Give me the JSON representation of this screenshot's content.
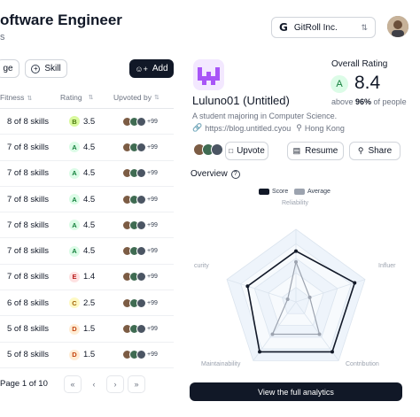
{
  "header": {
    "title": "oftware Engineer",
    "subtitle": "s",
    "org_name": "GitRoll Inc.",
    "org_logo": "G"
  },
  "toolbar": {
    "left_button_label": "ge",
    "skill_label": "Skill",
    "add_label": "Add"
  },
  "table": {
    "columns": [
      "Fitness",
      "Rating",
      "Upvoted by"
    ],
    "rows": [
      {
        "fitness": "8 of 8 skills",
        "grade": "B",
        "score": "3.5",
        "extra": "+99"
      },
      {
        "fitness": "7 of 8 skills",
        "grade": "A",
        "score": "4.5",
        "extra": "+99"
      },
      {
        "fitness": "7 of 8 skills",
        "grade": "A",
        "score": "4.5",
        "extra": "+99"
      },
      {
        "fitness": "7 of 8 skills",
        "grade": "A",
        "score": "4.5",
        "extra": "+99"
      },
      {
        "fitness": "7 of 8 skills",
        "grade": "A",
        "score": "4.5",
        "extra": "+99"
      },
      {
        "fitness": "7 of 8 skills",
        "grade": "A",
        "score": "4.5",
        "extra": "+99"
      },
      {
        "fitness": "7 of 8 skills",
        "grade": "E",
        "score": "1.4",
        "extra": "+99"
      },
      {
        "fitness": "6 of 8 skills",
        "grade": "C",
        "score": "2.5",
        "extra": "+99"
      },
      {
        "fitness": "5 of 8 skills",
        "grade": "D",
        "score": "1.5",
        "extra": "+99"
      },
      {
        "fitness": "5 of 8 skills",
        "grade": "D",
        "score": "1.5",
        "extra": "+99"
      }
    ]
  },
  "pagination": {
    "label": "Page 1 of 10",
    "first": "«",
    "prev": "‹",
    "next": "›",
    "last": "»"
  },
  "profile": {
    "name": "Luluno01 (Untitled)",
    "bio": "A student majoring in Computer Science.",
    "url": "https://blog.untitled.cyou",
    "location": "Hong Kong",
    "upvote_label": "Upvote",
    "resume_label": "Resume",
    "share_label": "Share"
  },
  "rating": {
    "label": "Overall Rating",
    "grade": "A",
    "value": "8.4",
    "above_prefix": "above ",
    "above_percent": "96%",
    "above_suffix": " of people"
  },
  "overview": {
    "title": "Overview",
    "legend_score": "Score",
    "legend_average": "Average",
    "axes": [
      "Reliability",
      "Influer",
      "Contribution",
      "Maintainability",
      "curity"
    ]
  },
  "chart_data": {
    "type": "radar",
    "axes": [
      "Reliability",
      "Influer",
      "Contribution",
      "Maintainability",
      "curity"
    ],
    "max": 1,
    "series": [
      {
        "name": "Score",
        "values": [
          0.7,
          0.85,
          0.85,
          0.85,
          0.7
        ]
      },
      {
        "name": "Average",
        "values": [
          0.55,
          0.2,
          0.55,
          0.55,
          0.12
        ]
      }
    ]
  },
  "analytics_label": "View the full analytics",
  "colors": {
    "primary": "#111827",
    "score": "#111827",
    "average": "#9ca3af",
    "grade_A_bg": "#dcfce7",
    "grade_A_fg": "#15803d",
    "grade_B_bg": "#d9f99d",
    "grade_B_fg": "#4d7c0f",
    "grade_C_bg": "#fef9c3",
    "grade_C_fg": "#a16207",
    "grade_D_bg": "#ffedd5",
    "grade_D_fg": "#c2410c",
    "grade_E_bg": "#fee2e2",
    "grade_E_fg": "#b91c1c"
  }
}
